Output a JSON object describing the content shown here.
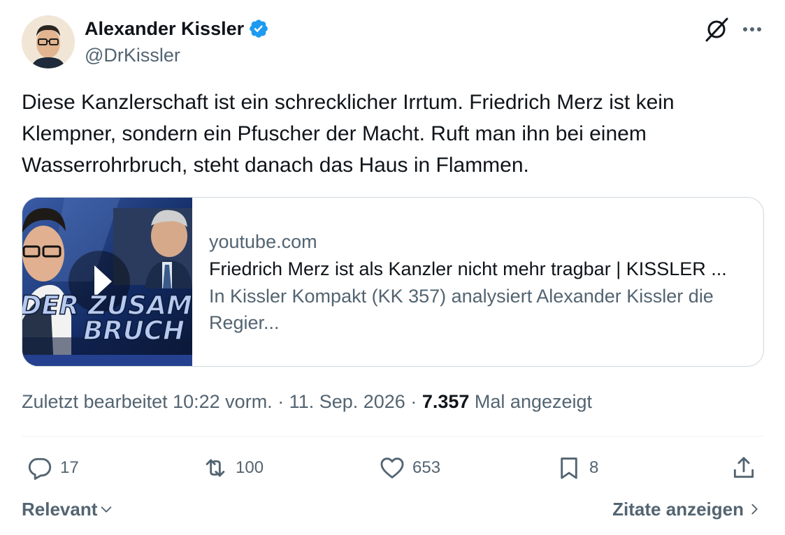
{
  "author": {
    "name": "Alexander Kissler",
    "handle": "@DrKissler"
  },
  "tweet": {
    "text": "Diese Kanzlerschaft ist ein schrecklicher Irrtum. Friedrich Merz ist kein Klempner, sondern ein Pfuscher der Macht. Ruft man ihn bei einem Wasserrohrbruch, steht danach das Haus in Flammen."
  },
  "card": {
    "domain": "youtube.com",
    "title": "Friedrich Merz ist als Kanzler nicht mehr tragbar | KISSLER ...",
    "description": "In Kissler Kompakt (KK 357) analysiert Alexander Kissler die Regier...",
    "thumbnail_text_line1": "DER ZUSAM",
    "thumbnail_text_line2": "BRUCH"
  },
  "meta": {
    "edited_label": "Zuletzt bearbeitet 10:22 vorm. · 11. Sep. 2026 ·",
    "views_count": "7.357",
    "views_label": "Mal angezeigt"
  },
  "actions": {
    "replies": "17",
    "reposts": "100",
    "likes": "653",
    "bookmarks": "8"
  },
  "footer": {
    "sort_label": "Relevant",
    "quotes_label": "Zitate anzeigen"
  },
  "colors": {
    "verified": "#1d9bf0",
    "secondary_text": "#536471",
    "primary_text": "#0f1419",
    "border": "#cfd9de"
  }
}
